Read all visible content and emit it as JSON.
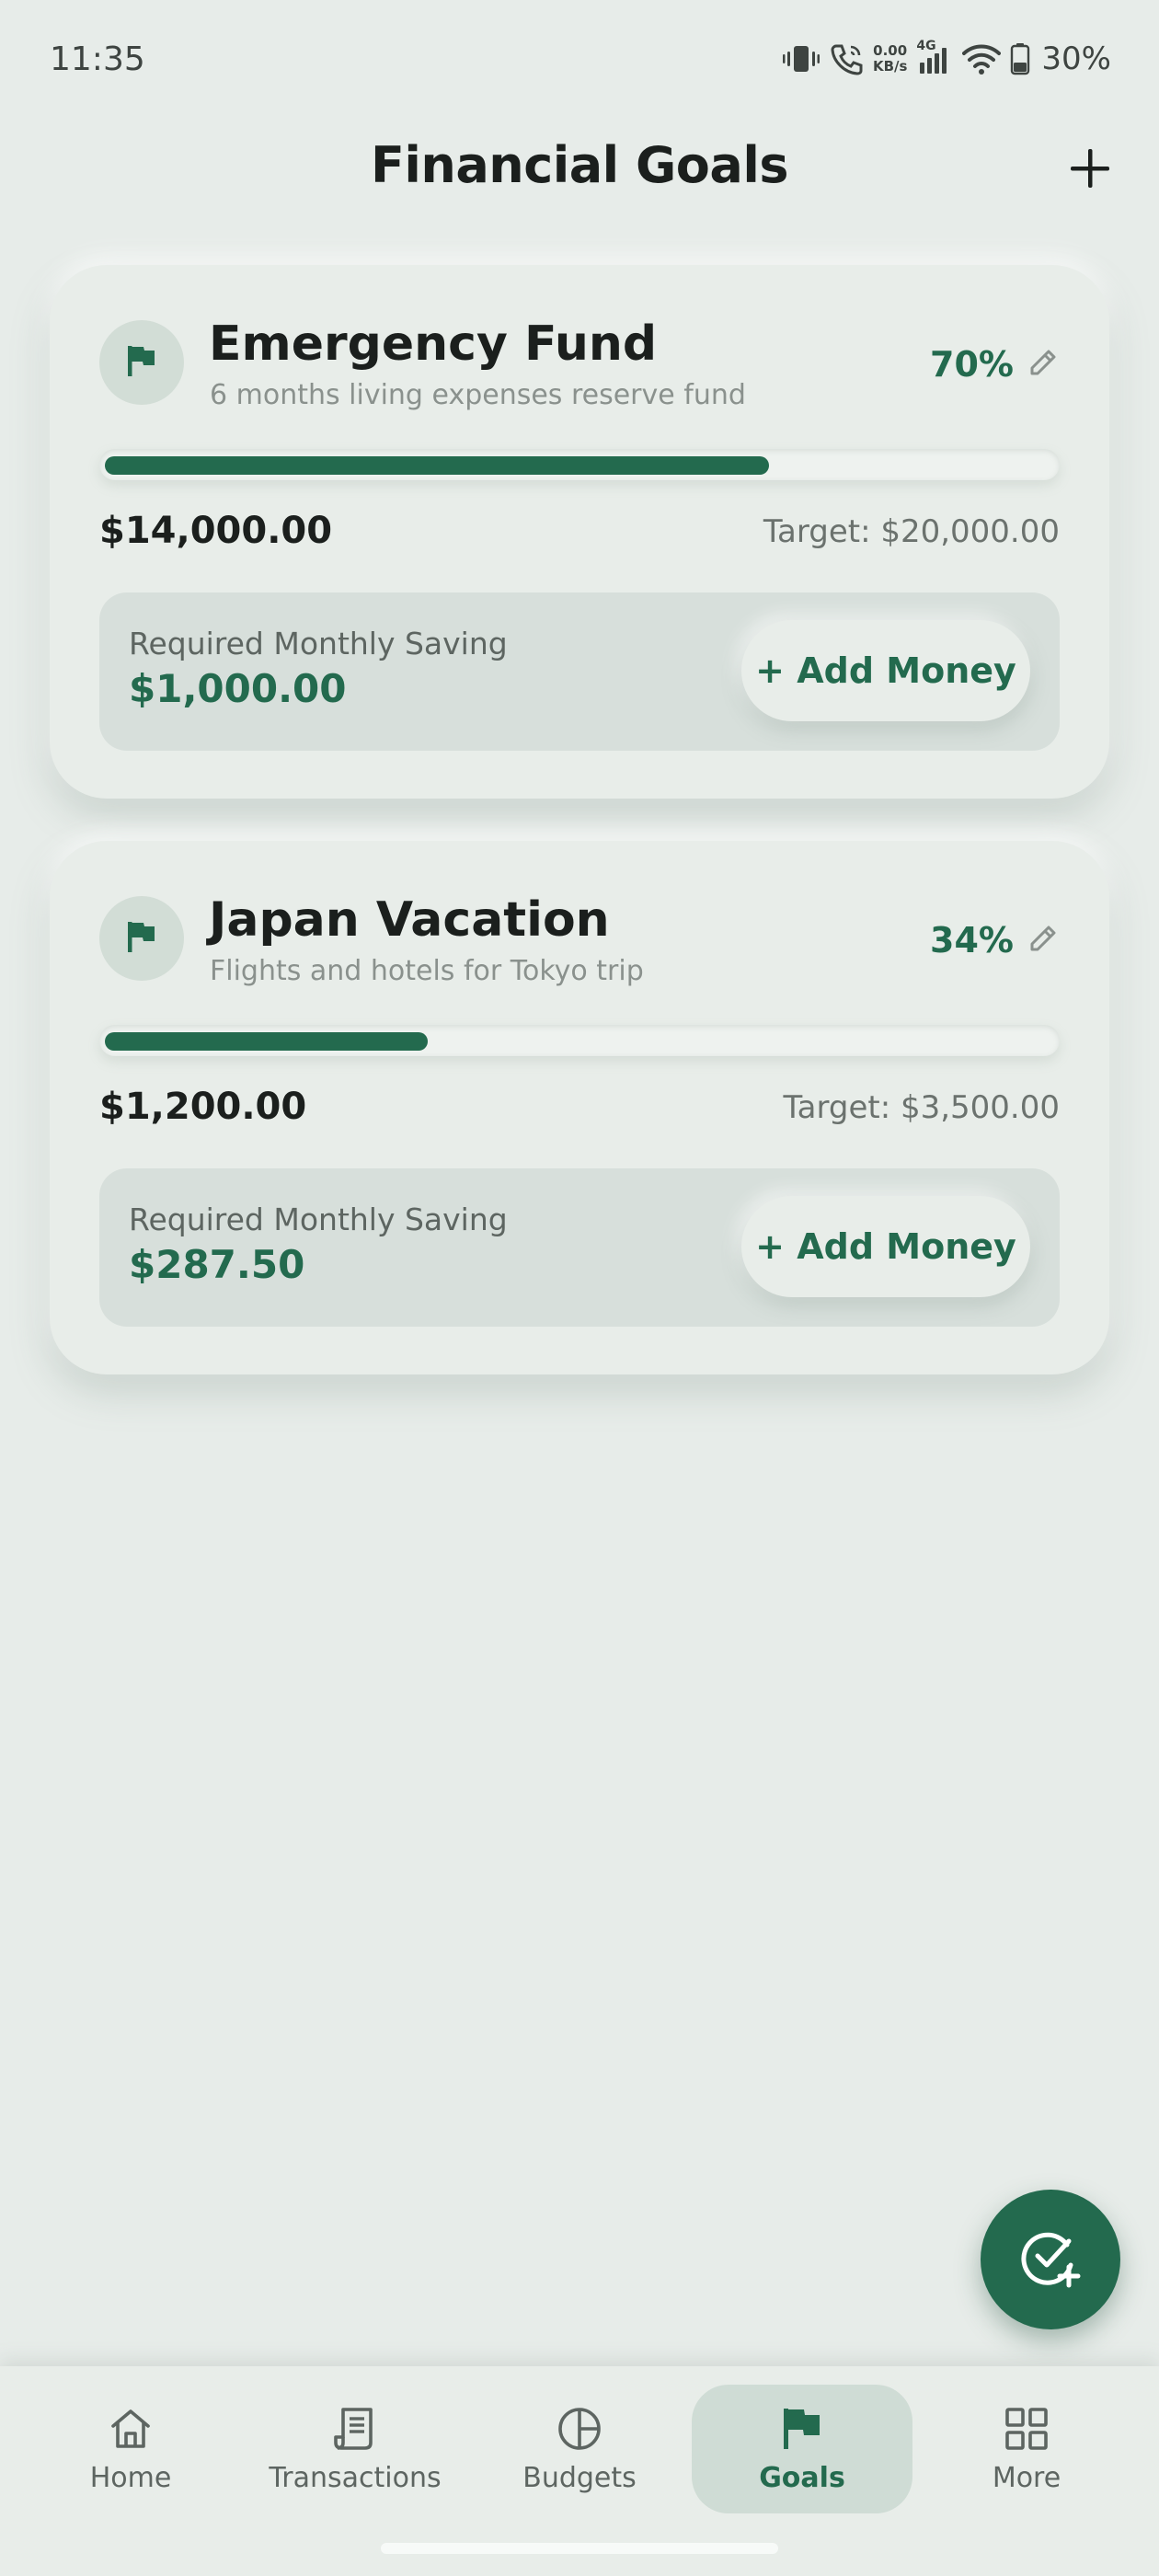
{
  "status_bar": {
    "time": "11:35",
    "net_speed_value": "0.00",
    "net_speed_unit": "KB/s",
    "network_type": "4G",
    "battery": "30%",
    "icons": [
      "vibrate-icon",
      "call-icon",
      "signal-icon",
      "wifi-icon",
      "battery-icon"
    ]
  },
  "header": {
    "title": "Financial Goals",
    "add_icon": "plus-icon"
  },
  "colors": {
    "accent": "#236a4e",
    "background": "#e7ece9",
    "card": "#e8ede9",
    "panel": "#d7dfdb"
  },
  "goals": [
    {
      "title": "Emergency Fund",
      "description": "6 months living expenses reserve fund",
      "percent_label": "70%",
      "progress": 0.7,
      "saved": "$14,000.00",
      "target": "Target: $20,000.00",
      "monthly_label": "Required Monthly Saving",
      "monthly_value": "$1,000.00",
      "button_label": "+ Add Money",
      "icon": "flag-icon"
    },
    {
      "title": "Japan Vacation",
      "description": "Flights and hotels for Tokyo trip",
      "percent_label": "34%",
      "progress": 0.34,
      "saved": "$1,200.00",
      "target": "Target: $3,500.00",
      "monthly_label": "Required Monthly Saving",
      "monthly_value": "$287.50",
      "button_label": "+ Add Money",
      "icon": "flag-icon"
    }
  ],
  "fab": {
    "icon": "check-add-icon"
  },
  "nav": {
    "items": [
      {
        "label": "Home",
        "icon": "home-icon",
        "active": false
      },
      {
        "label": "Transactions",
        "icon": "receipt-icon",
        "active": false
      },
      {
        "label": "Budgets",
        "icon": "pie-chart-icon",
        "active": false
      },
      {
        "label": "Goals",
        "icon": "flag-icon",
        "active": true
      },
      {
        "label": "More",
        "icon": "grid-icon",
        "active": false
      }
    ]
  }
}
